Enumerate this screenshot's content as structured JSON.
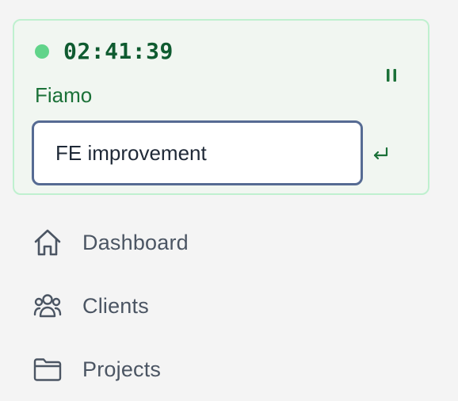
{
  "timer": {
    "elapsed": "02:41:39",
    "status_color": "#61d48a",
    "client": "Fiamo",
    "task_value": "FE improvement",
    "pause_icon": "pause-icon",
    "submit_icon": "enter-icon"
  },
  "nav": {
    "items": [
      {
        "label": "Dashboard",
        "icon": "home-icon"
      },
      {
        "label": "Clients",
        "icon": "users-icon"
      },
      {
        "label": "Projects",
        "icon": "folder-icon"
      }
    ]
  },
  "colors": {
    "card_bg": "#f1f6f1",
    "card_border": "#bff0cf",
    "accent_green": "#1b7138",
    "input_border": "#566b93",
    "nav_text": "#4b5563"
  }
}
